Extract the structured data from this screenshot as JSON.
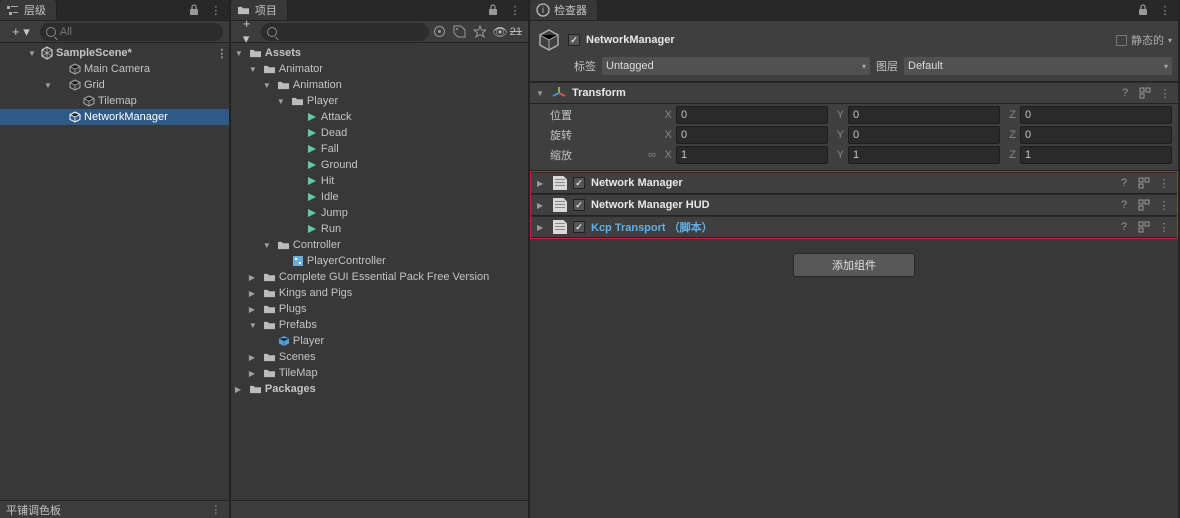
{
  "hierarchy": {
    "tab": "层级",
    "search_placeholder": "All",
    "scene": "SampleScene*",
    "items": [
      {
        "name": "Main Camera"
      },
      {
        "name": "Grid"
      },
      {
        "name": "Tilemap"
      },
      {
        "name": "NetworkManager"
      }
    ],
    "footer": "平铺调色板"
  },
  "project": {
    "tab": "项目",
    "search_placeholder": "",
    "visibility_count": "21",
    "tree": {
      "assets": "Assets",
      "animator": "Animator",
      "animation": "Animation",
      "player": "Player",
      "clips": [
        "Attack",
        "Dead",
        "Fall",
        "Ground",
        "Hit",
        "Idle",
        "Jump",
        "Run"
      ],
      "controller": "Controller",
      "player_controller": "PlayerController",
      "gui_pack": "Complete GUI Essential Pack Free Version",
      "kings_pigs": "Kings and Pigs",
      "plugs": "Plugs",
      "prefabs": "Prefabs",
      "prefab_player": "Player",
      "scenes": "Scenes",
      "tilemap": "TileMap",
      "packages": "Packages"
    }
  },
  "inspector": {
    "tab": "检查器",
    "name": "NetworkManager",
    "static_label": "静态的",
    "tag_label": "标签",
    "tag_value": "Untagged",
    "layer_label": "图层",
    "layer_value": "Default",
    "transform": {
      "title": "Transform",
      "position_label": "位置",
      "rotation_label": "旋转",
      "scale_label": "缩放",
      "position": {
        "x": "0",
        "y": "0",
        "z": "0"
      },
      "rotation": {
        "x": "0",
        "y": "0",
        "z": "0"
      },
      "scale": {
        "x": "1",
        "y": "1",
        "z": "1"
      }
    },
    "components": [
      {
        "title": "Network Manager"
      },
      {
        "title": "Network Manager HUD"
      },
      {
        "title": "Kcp Transport",
        "suffix": "（脚本）",
        "highlight": true
      }
    ],
    "add_component": "添加组件"
  }
}
